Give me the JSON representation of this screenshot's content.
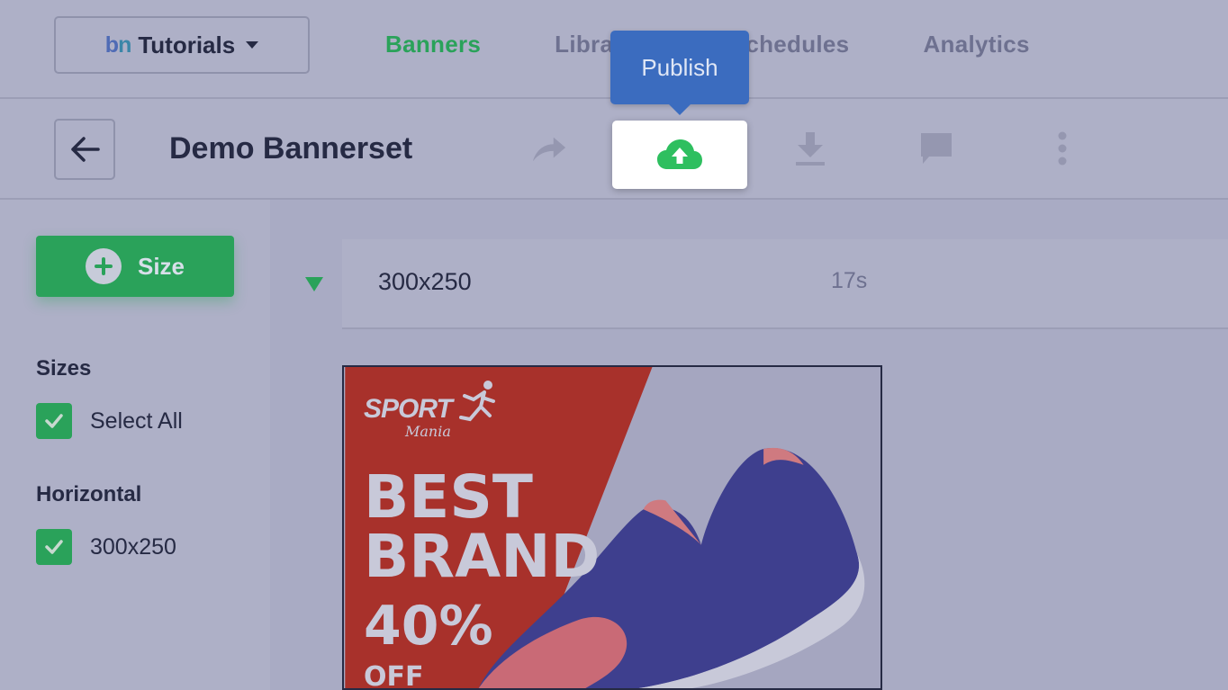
{
  "workspace": {
    "logo_b": "b",
    "logo_n": "n",
    "name": "Tutorials"
  },
  "nav": {
    "tabs": [
      {
        "label": "Banners",
        "active": true
      },
      {
        "label": "Libraries"
      },
      {
        "label": "Schedules"
      },
      {
        "label": "Analytics"
      }
    ]
  },
  "toolbar": {
    "title": "Demo Bannerset",
    "tooltip": "Publish",
    "icons": [
      "back-arrow-icon",
      "share-icon",
      "cloud-upload-icon",
      "download-icon",
      "comment-icon",
      "more-vertical-icon"
    ]
  },
  "sidebar": {
    "add_size_label": "Size",
    "sizes_heading": "Sizes",
    "select_all_label": "Select All",
    "horizontal_heading": "Horizontal",
    "size_item_label": "300x250"
  },
  "main": {
    "row_size": "300x250",
    "row_duration": "17s"
  },
  "banner": {
    "logo": "SPORT",
    "logo_sub": "Mania",
    "line1": "BEST",
    "line2": "BRAND",
    "line3": "40%",
    "line4": "OFF"
  },
  "colors": {
    "accent_green": "#2aa25a",
    "tooltip_blue": "#3b6cbf",
    "banner_red": "#a8312b"
  }
}
